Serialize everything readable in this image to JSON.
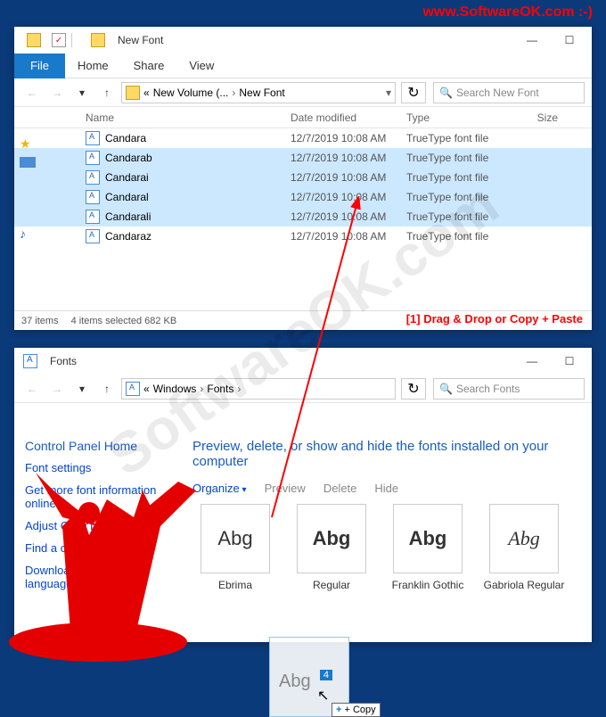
{
  "watermark": {
    "url": "www.SoftwareOK.com :-)",
    "diag": "SoftwareOK.com"
  },
  "annotation": {
    "drag": "[1] Drag & Drop or Copy + Paste"
  },
  "top_window": {
    "title": "New Font",
    "tabs": {
      "file": "File",
      "home": "Home",
      "share": "Share",
      "view": "View"
    },
    "breadcrumb": {
      "prefix": "«",
      "vol": "New Volume (...",
      "sep": "›",
      "folder": "New Font"
    },
    "search_placeholder": "Search New Font",
    "columns": {
      "name": "Name",
      "date": "Date modified",
      "type": "Type",
      "size": "Size"
    },
    "files": [
      {
        "name": "Candara",
        "date": "12/7/2019 10:08 AM",
        "type": "TrueType font file",
        "selected": false
      },
      {
        "name": "Candarab",
        "date": "12/7/2019 10:08 AM",
        "type": "TrueType font file",
        "selected": true
      },
      {
        "name": "Candarai",
        "date": "12/7/2019 10:08 AM",
        "type": "TrueType font file",
        "selected": true
      },
      {
        "name": "Candaral",
        "date": "12/7/2019 10:08 AM",
        "type": "TrueType font file",
        "selected": true
      },
      {
        "name": "Candarali",
        "date": "12/7/2019 10:08 AM",
        "type": "TrueType font file",
        "selected": true
      },
      {
        "name": "Candaraz",
        "date": "12/7/2019 10:08 AM",
        "type": "TrueType font file",
        "selected": false
      }
    ],
    "status": {
      "items": "37 items",
      "selected": "4 items selected  682 KB"
    }
  },
  "fonts_window": {
    "title": "Fonts",
    "breadcrumb": {
      "prefix": "«",
      "win": "Windows",
      "sep": "›",
      "folder": "Fonts"
    },
    "search_placeholder": "Search Fonts",
    "sidebar": {
      "home": "Control Panel Home",
      "settings": "Font settings",
      "more": "Get more font information online",
      "cleartype": "Adjust ClearType text",
      "findchar": "Find a character",
      "download": "Download fonts for all languages"
    },
    "heading": "Preview, delete, or show and hide the fonts installed on your computer",
    "toolbar": {
      "organize": "Organize",
      "preview": "Preview",
      "delete": "Delete",
      "hide": "Hide"
    },
    "tiles": [
      {
        "name": "Ebrima",
        "sample": "Abg",
        "stack": true
      },
      {
        "name": "Regular",
        "sample": "Abg",
        "stack": false
      },
      {
        "name": "Franklin Gothic",
        "sample": "Abg",
        "stack": true
      },
      {
        "name": "Gabriola Regular",
        "sample": "Abg",
        "stack": false,
        "italic": true
      }
    ],
    "drag": {
      "count": "4",
      "sample": "Abg",
      "tip": "+ Copy"
    }
  }
}
